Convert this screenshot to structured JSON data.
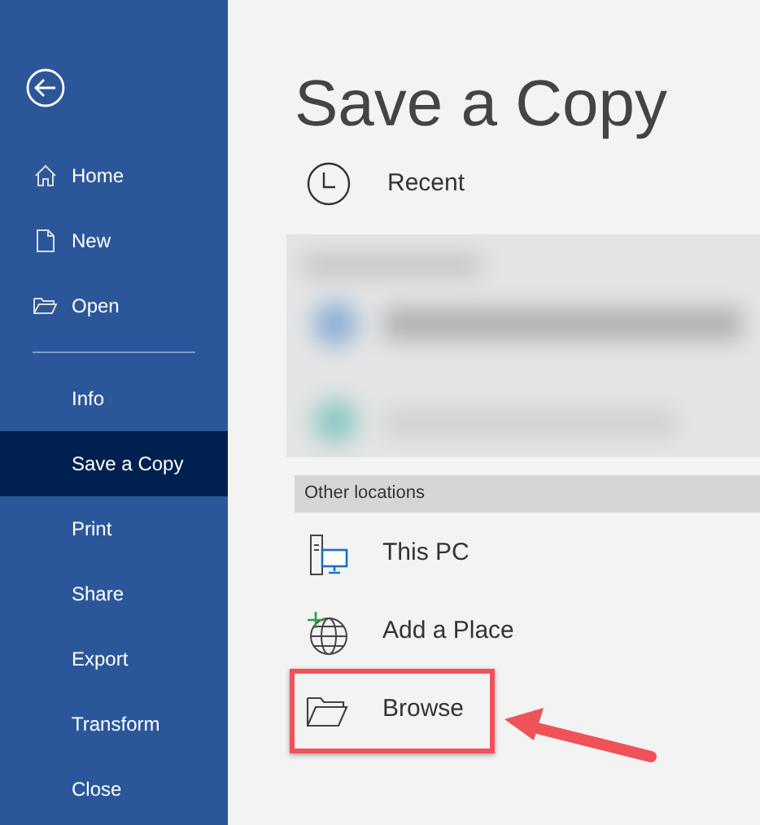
{
  "sidebar": {
    "top_items": [
      {
        "label": "Home",
        "selected": false
      },
      {
        "label": "New",
        "selected": false
      },
      {
        "label": "Open",
        "selected": false
      }
    ],
    "items": [
      {
        "label": "Info",
        "selected": false
      },
      {
        "label": "Save a Copy",
        "selected": true
      },
      {
        "label": "Print",
        "selected": false
      },
      {
        "label": "Share",
        "selected": false
      },
      {
        "label": "Export",
        "selected": false
      },
      {
        "label": "Transform",
        "selected": false
      },
      {
        "label": "Close",
        "selected": false
      }
    ]
  },
  "title": "Save a Copy",
  "recent": {
    "label": "Recent"
  },
  "locations_header": "Other locations",
  "locations": [
    {
      "label": "This PC",
      "highlighted": false
    },
    {
      "label": "Add a Place",
      "highlighted": false
    },
    {
      "label": "Browse",
      "highlighted": true
    }
  ]
}
